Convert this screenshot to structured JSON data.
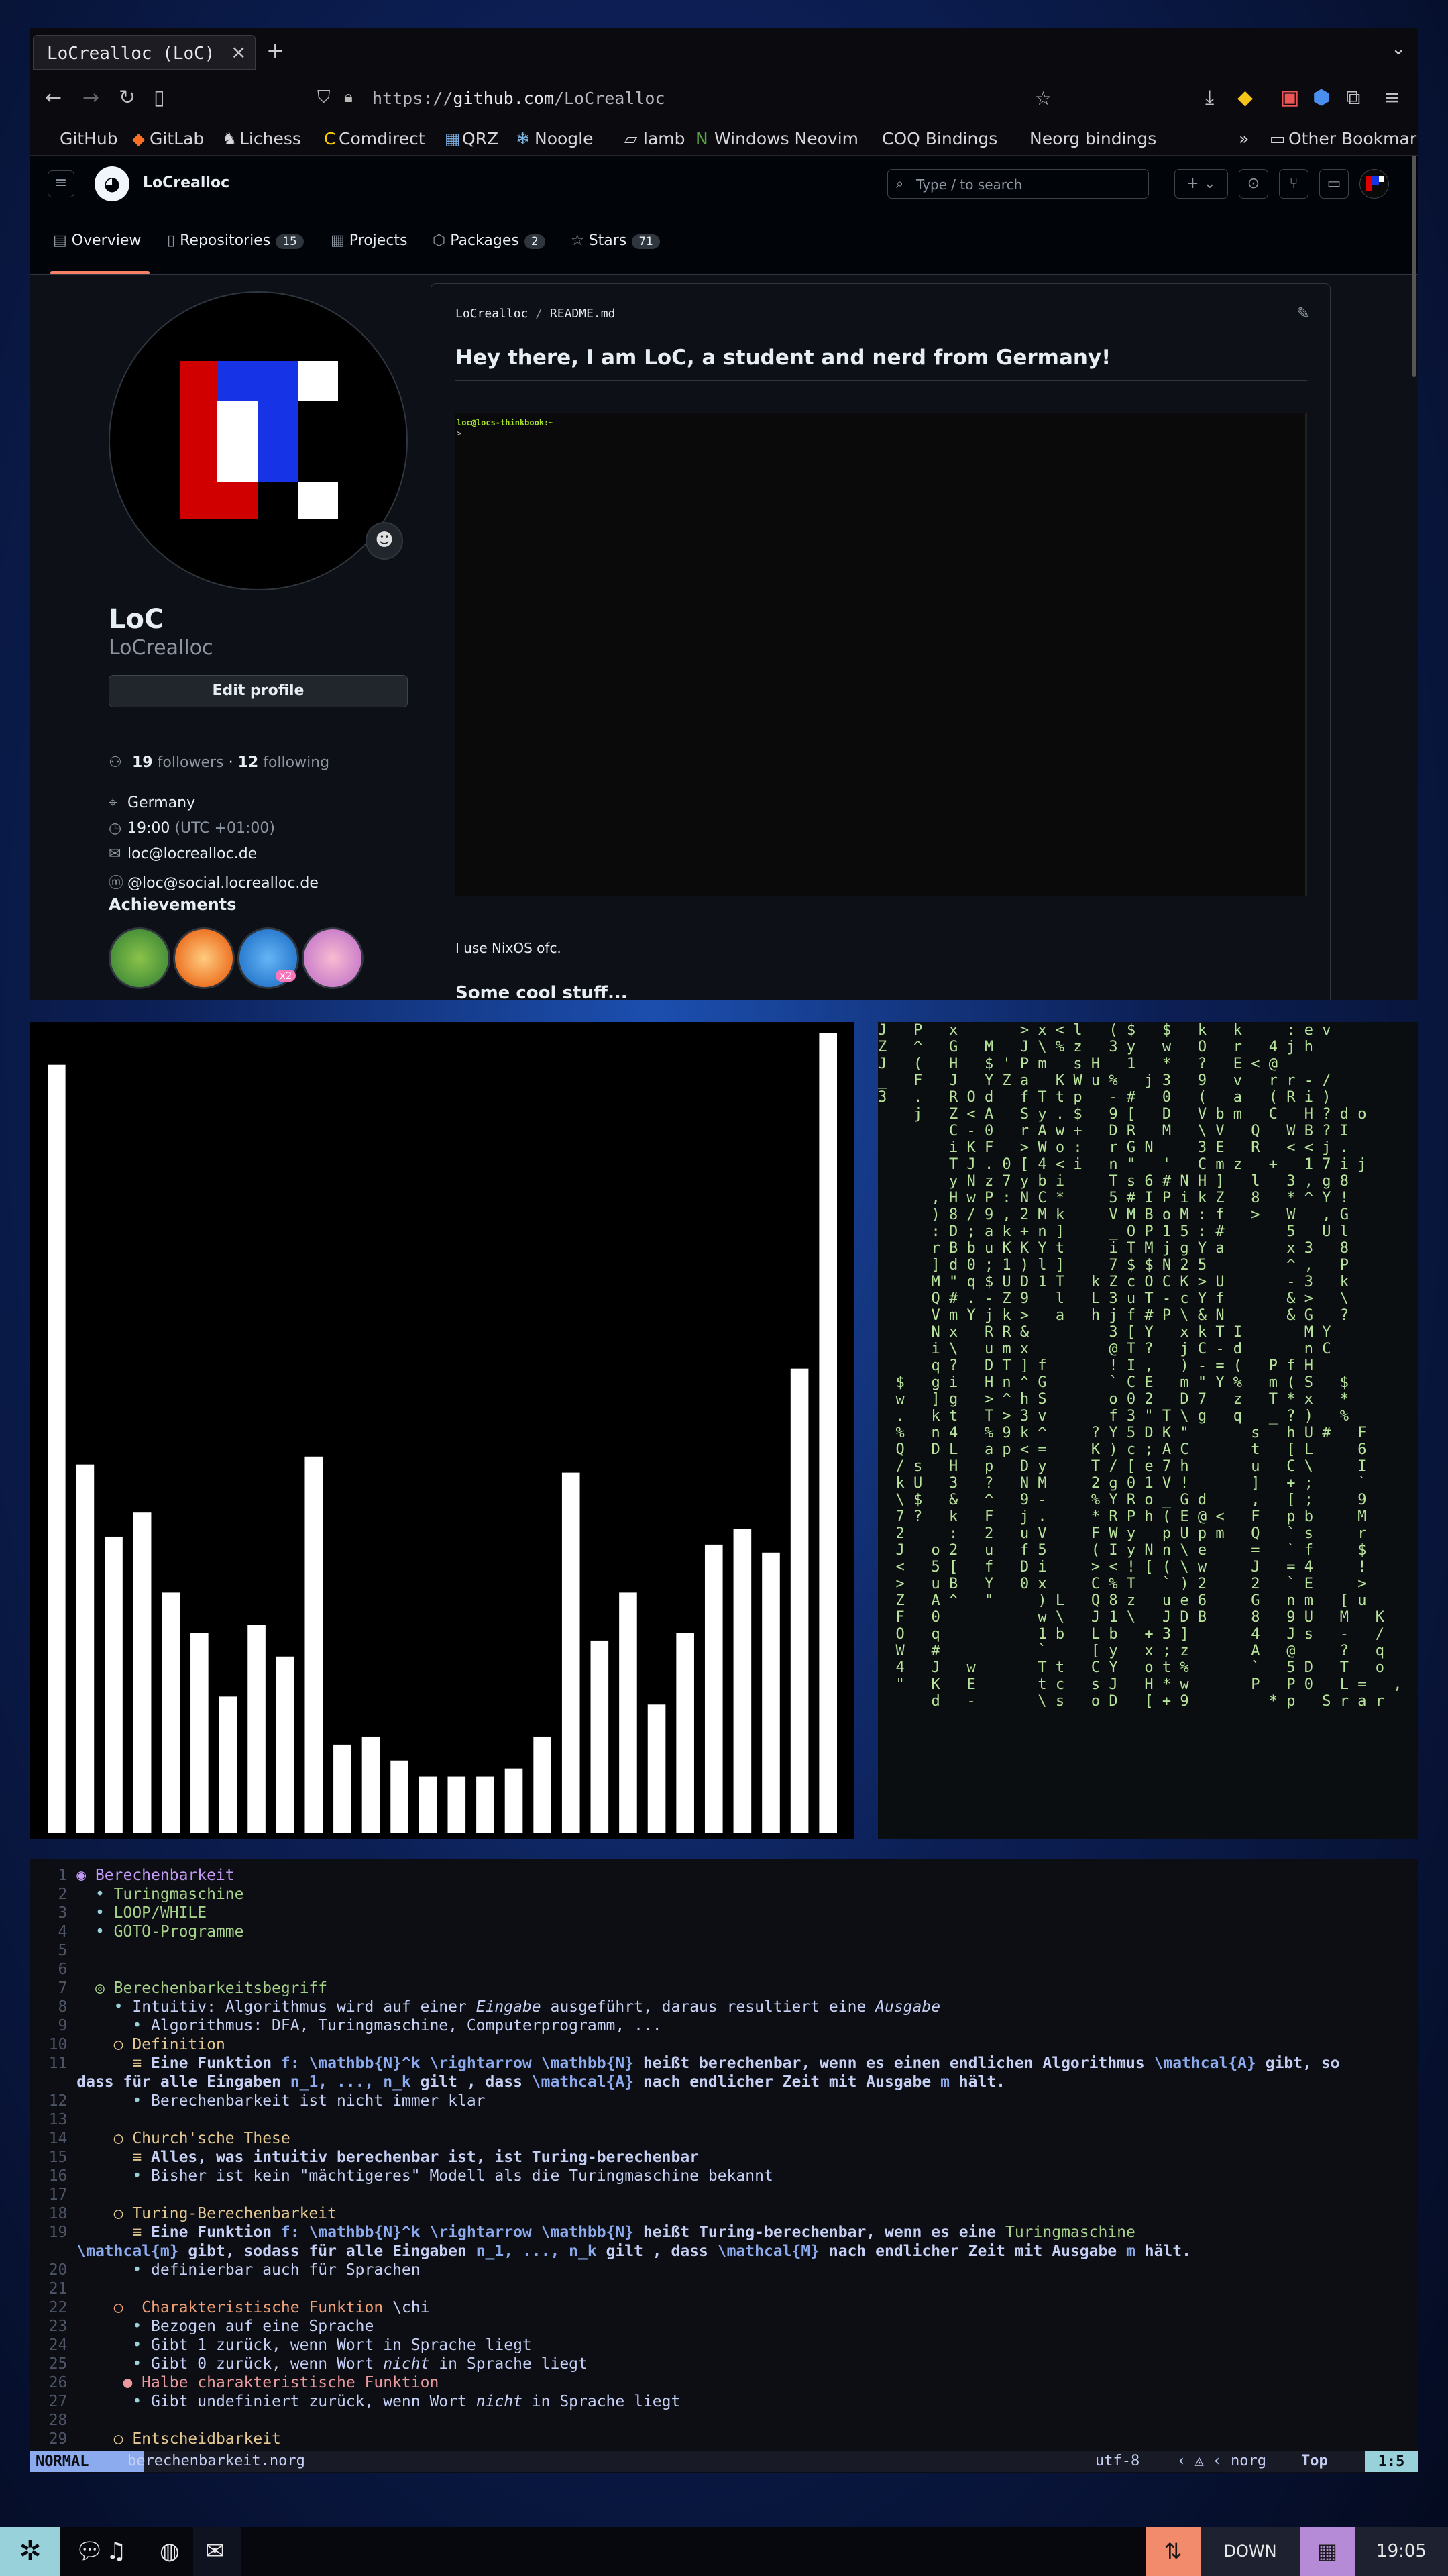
{
  "browser": {
    "tab_title": "LoCrealloc (LoC)",
    "url_scheme": "https://",
    "url_host": "github.com",
    "url_path": "/LoCrealloc",
    "bookmarks": [
      "GitHub",
      "GitLab",
      "Lichess",
      "Comdirect",
      "QRZ",
      "Noogle",
      "lamb",
      "Windows Neovim",
      "COQ Bindings",
      "Neorg bindings"
    ],
    "other_bookmarks": "Other Bookmarks"
  },
  "github": {
    "username": "LoCrealloc",
    "search_placeholder": "Type / to search",
    "tabs": [
      {
        "label": "Overview",
        "count": ""
      },
      {
        "label": "Repositories",
        "count": "15"
      },
      {
        "label": "Projects",
        "count": ""
      },
      {
        "label": "Packages",
        "count": "2"
      },
      {
        "label": "Stars",
        "count": "71"
      }
    ],
    "profile": {
      "name": "LoC",
      "login": "LoCrealloc",
      "edit_button": "Edit profile",
      "followers": "19",
      "followers_label": "followers",
      "following": "12",
      "following_label": "following",
      "location": "Germany",
      "time": "19:00",
      "timezone": "(UTC +01:00)",
      "email": "loc@locrealloc.de",
      "mastodon": "@loc@social.locrealloc.de",
      "achievements_title": "Achievements",
      "achievement_multiplier": "x2"
    },
    "readme": {
      "path_user": "LoCrealloc",
      "path_file": "README.md",
      "heading": "Hey there, I am LoC, a student and nerd from Germany!",
      "terminal_prompt": "loc@locs-thinkbook:~",
      "terminal_cursor": ">",
      "paragraph": "I use NixOS ofc.",
      "subheading": "Some cool stuff..."
    }
  },
  "visualizer": {
    "levels": [
      0.96,
      0.46,
      0.37,
      0.4,
      0.3,
      0.25,
      0.17,
      0.26,
      0.22,
      0.47,
      0.11,
      0.12,
      0.09,
      0.07,
      0.07,
      0.07,
      0.08,
      0.12,
      0.45,
      0.24,
      0.3,
      0.16,
      0.25,
      0.36,
      0.38,
      0.35,
      0.58,
      1.0
    ],
    "bar_color": "#ffffff"
  },
  "matrix": {
    "lines": [
      "J   P   x       > x < l   ( $   $   k   k     : e v",
      "Z   ^   G   M   J \\ % z   3 y   w   O   r   4 j h",
      "J   (   H   $ ' P m   s H   1   *   ?   E < @",
      "_   F   J   Y Z a   K W u %   j 3   9   v   r r - /",
      "3   .   R O d   f T t p   - #   0   (   a   ( R i )",
      "    j   Z < A   S y . $   9 [   D   V b m   C   H ? d o",
      "        C - 0   r A w +   D R   M   \\ V   Q   W B ? I",
      "        i K F   > W o :   r G N     3 E   R   < < j .",
      "        T J . 0 [ 4 < i   n \"   '   C m z   +   1 7 i j",
      "        y N z 7 y b i     T s 6 # N H ]   l   3 , g 8",
      "      , H w P : N C *     5 # I P i k Z   8   * ^ Y !",
      "      ) 8 / 9 , 2 M k     V M B o M : f   >   W   , G",
      "      : D ; a k + n ]     _ O P 1 5 : #       5   U l",
      "      r B b u K K Y t     i T M j g Y a       x 3   8",
      "      ] d 0 ; 1 ) l ]     7 $ $ N 2 5         ^ ,   P",
      "      M \" q $ U D 1 T   k Z c O C K > U       - 3   k",
      "      Q # . - Z 9   l   L 3 u T - c Y f       & >   \\",
      "      V m Y j k >   a   h j f # P \\ & N       & G   ?",
      "      N x   R R &         3 [ Y   x k T I       M Y",
      "      i \\   u m x         @ T ?   j C - d       n C",
      "      q ?   D T ] f       ! I ,   ) - = (   P f H",
      "  $   g i   H n ^ G       ` C E   m \" Y %   m ( S   $",
      "  w   ] g   > ^ h S       o 0 2   D 7   z   T * x   *",
      "  .   k t   T > 3 v       f 3 \" T \\ g   q   _ ? )   %",
      "  %   n 4   % 9 k ^     ? Y 5 D K \"       s   h U #   F",
      "  Q   D L   a p < =     K ) c ; A C       t   [ L     6",
      "  / s   H   p   D y     T / [ e 7 h       u   C \\     I",
      "  k U   3   ?   N M     2 g 0 1 V !       ]   + ;     `",
      "  \\ $   &   ^   9 -     % Y R o _ G d     ,   [ ;     9",
      "  7 ?   k   F   j .     * R P h ( E @ <   F   p b     M",
      "  2     :   2   u V     F W y   p U p m   Q   ` s     r",
      "  J   o 2   u   f 5     ( I y N n \\ e     =   ` f     $",
      "  <   5 [   f   D i     > < ! [ ( \\ w     J   = 4     !",
      "  >   u B   Y   0 x     C % T   ` ) 2     2   ` E     >",
      "  Z   A ^   \"     ) L   Q 8 z   u e 6     G   n m   [ u",
      "  F   0           w \\   J 1 \\   J D B     8   9 U   M   K",
      "  O   q           1 b   L b   + 3 ]       4   J s   -   /",
      "  W   #           `     [ y   x ; z       A   @     ?   q",
      "  4   J   w       T t   C Y   o t %       `   5 D   T   o",
      "  \"   K   E       t c   s J   H * w       P   P 0   L =   ,",
      "      d   -       \\ s   o D   [ + 9         * p   S r a r"
    ]
  },
  "nvim": {
    "lines": [
      {
        "n": "1",
        "segs": [
          [
            "h1",
            "◉ Berechenbarkeit"
          ]
        ]
      },
      {
        "n": "2",
        "segs": [
          [
            "bl",
            "  • "
          ],
          [
            "h2",
            "Turingmaschine"
          ]
        ]
      },
      {
        "n": "3",
        "segs": [
          [
            "bl",
            "  • "
          ],
          [
            "h2",
            "LOOP/WHILE"
          ]
        ]
      },
      {
        "n": "4",
        "segs": [
          [
            "bl",
            "  • "
          ],
          [
            "h2",
            "GOTO-Programme"
          ]
        ]
      },
      {
        "n": "5",
        "segs": []
      },
      {
        "n": "6",
        "segs": []
      },
      {
        "n": "7",
        "segs": [
          [
            "h2",
            "  ◎ Berechenbarkeitsbegriff"
          ]
        ]
      },
      {
        "n": "8",
        "segs": [
          [
            "bl",
            "    • "
          ],
          [
            "tx",
            "Intuitiv: Algorithmus wird auf einer "
          ],
          [
            "tx it",
            "Eingabe"
          ],
          [
            "tx",
            " ausgeführt, daraus resultiert eine "
          ],
          [
            "tx it",
            "Ausgabe"
          ]
        ]
      },
      {
        "n": "9",
        "segs": [
          [
            "bl",
            "      • "
          ],
          [
            "tx",
            "Algorithmus: DFA, Turingmaschine, Computerprogramm, ..."
          ]
        ]
      },
      {
        "n": "10",
        "segs": [
          [
            "h3",
            "    ○ Definition"
          ]
        ]
      },
      {
        "n": "11",
        "segs": [
          [
            "h3",
            "      ≡ "
          ],
          [
            "bd",
            "Eine Funktion "
          ],
          [
            "mt",
            "f: \\mathbb{N}^k \\rightarrow \\mathbb{N}"
          ],
          [
            "bd",
            " heißt berechenbar, wenn es einen endlichen Algorithmus "
          ],
          [
            "mt",
            "\\mathcal{A}"
          ],
          [
            "bd",
            " gibt, so"
          ]
        ]
      },
      {
        "n": "",
        "segs": [
          [
            "bd",
            "dass für alle Eingaben "
          ],
          [
            "mt",
            "n_1, ..., n_k"
          ],
          [
            "bd",
            " gilt , dass "
          ],
          [
            "mt",
            "\\mathcal{A}"
          ],
          [
            "bd",
            " nach endlicher Zeit mit Ausgabe "
          ],
          [
            "mt",
            "m"
          ],
          [
            "bd",
            " hält."
          ]
        ]
      },
      {
        "n": "12",
        "segs": [
          [
            "bl",
            "      • "
          ],
          [
            "tx",
            "Berechenbarkeit ist nicht immer klar"
          ]
        ]
      },
      {
        "n": "13",
        "segs": []
      },
      {
        "n": "14",
        "segs": [
          [
            "h3",
            "    ○ Church'sche These"
          ]
        ]
      },
      {
        "n": "15",
        "segs": [
          [
            "h3",
            "      ≡ "
          ],
          [
            "bd",
            "Alles, was intuitiv berechenbar ist, ist Turing-berechenbar"
          ]
        ]
      },
      {
        "n": "16",
        "segs": [
          [
            "bl",
            "      • "
          ],
          [
            "tx",
            "Bisher ist kein \"mächtigeres\" Modell als die Turingmaschine bekannt"
          ]
        ]
      },
      {
        "n": "17",
        "segs": []
      },
      {
        "n": "18",
        "segs": [
          [
            "h3",
            "    ○ Turing-Berechenbarkeit"
          ]
        ]
      },
      {
        "n": "19",
        "segs": [
          [
            "h3",
            "      ≡ "
          ],
          [
            "bd",
            "Eine Funktion "
          ],
          [
            "mt",
            "f: \\mathbb{N}^k \\rightarrow \\mathbb{N}"
          ],
          [
            "bd",
            " heißt Turing-berechenbar, wenn es eine "
          ],
          [
            "h2",
            "Turingmaschine"
          ]
        ]
      },
      {
        "n": "",
        "segs": [
          [
            "mt",
            "\\mathcal{m}"
          ],
          [
            "bd",
            " gibt, sodass für alle Eingaben "
          ],
          [
            "mt",
            "n_1, ..., n_k"
          ],
          [
            "bd",
            " gilt , dass "
          ],
          [
            "mt",
            "\\mathcal{M}"
          ],
          [
            "bd",
            " nach endlicher Zeit mit Ausgabe "
          ],
          [
            "mt",
            "m"
          ],
          [
            "bd",
            " hält."
          ]
        ]
      },
      {
        "n": "20",
        "segs": [
          [
            "bl",
            "      • "
          ],
          [
            "tx",
            "definierbar auch für Sprachen"
          ]
        ]
      },
      {
        "n": "21",
        "segs": []
      },
      {
        "n": "22",
        "segs": [
          [
            "h4",
            "    ○  Charakteristische Funktion "
          ],
          [
            "tx",
            "\\chi"
          ]
        ]
      },
      {
        "n": "23",
        "segs": [
          [
            "bl",
            "      • "
          ],
          [
            "tx",
            "Bezogen auf eine Sprache"
          ]
        ]
      },
      {
        "n": "24",
        "segs": [
          [
            "bl",
            "      • "
          ],
          [
            "tx",
            "Gibt 1 zurück, wenn Wort in Sprache liegt"
          ]
        ]
      },
      {
        "n": "25",
        "segs": [
          [
            "bl",
            "      • "
          ],
          [
            "tx",
            "Gibt 0 zurück, wenn Wort "
          ],
          [
            "tx it",
            "nicht"
          ],
          [
            "tx",
            " in Sprache liegt"
          ]
        ]
      },
      {
        "n": "26",
        "segs": [
          [
            "h5",
            "     ● Halbe charakteristische Funktion"
          ]
        ]
      },
      {
        "n": "27",
        "segs": [
          [
            "bl",
            "      • "
          ],
          [
            "tx",
            "Gibt undefiniert zurück, wenn Wort "
          ],
          [
            "tx it",
            "nicht"
          ],
          [
            "tx",
            " in Sprache liegt"
          ]
        ]
      },
      {
        "n": "28",
        "segs": []
      },
      {
        "n": "29",
        "segs": [
          [
            "h3",
            "    ○ Entscheidbarkeit"
          ]
        ]
      }
    ],
    "status": {
      "mode": "NORMAL",
      "file": "berechenbarkeit.norg",
      "encoding": "utf-8",
      "filetype": "norg",
      "position_label": "Top",
      "cursor": "1:5"
    }
  },
  "taskbar": {
    "network_status": "DOWN",
    "clock": "19:05"
  }
}
